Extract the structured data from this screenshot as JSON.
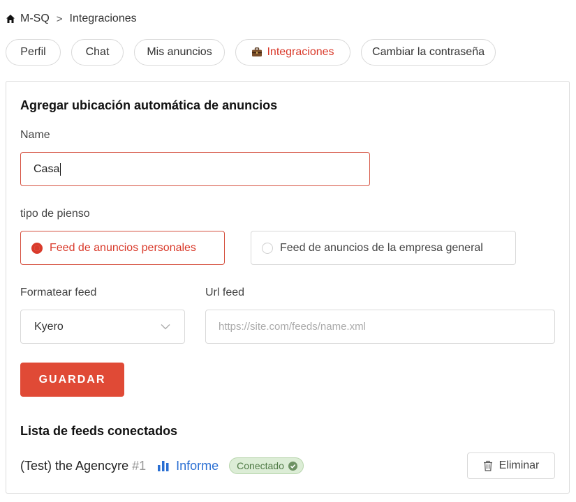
{
  "breadcrumb": {
    "home_icon": "home-icon",
    "root": "M-SQ",
    "separator": ">",
    "current": "Integraciones"
  },
  "tabs": [
    {
      "label": "Perfil",
      "active": false
    },
    {
      "label": "Chat",
      "active": false
    },
    {
      "label": "Mis anuncios",
      "active": false
    },
    {
      "label": "Integraciones",
      "active": true,
      "icon": "briefcase-icon"
    },
    {
      "label": "Cambiar la contraseña",
      "active": false
    }
  ],
  "form": {
    "title": "Agregar ubicación automática de anuncios",
    "name_label": "Name",
    "name_value": "Casa",
    "feed_type_label": "tipo de pienso",
    "feed_type_options": [
      {
        "label": "Feed de anuncios personales",
        "selected": true
      },
      {
        "label": "Feed de anuncios de la empresa general",
        "selected": false
      }
    ],
    "format_label": "Formatear feed",
    "format_value": "Kyero",
    "url_label": "Url feed",
    "url_placeholder": "https://site.com/feeds/name.xml",
    "save_label": "GUARDAR"
  },
  "feeds": {
    "title": "Lista de feeds conectados",
    "items": [
      {
        "name": "(Test) the Agencyre",
        "number": "#1",
        "report_label": "Informe",
        "status": "Conectado",
        "delete_label": "Eliminar"
      }
    ]
  },
  "colors": {
    "accent": "#e04a36",
    "link": "#2a6fd3",
    "success_bg": "#dcedd6",
    "success_text": "#4f7a45"
  }
}
